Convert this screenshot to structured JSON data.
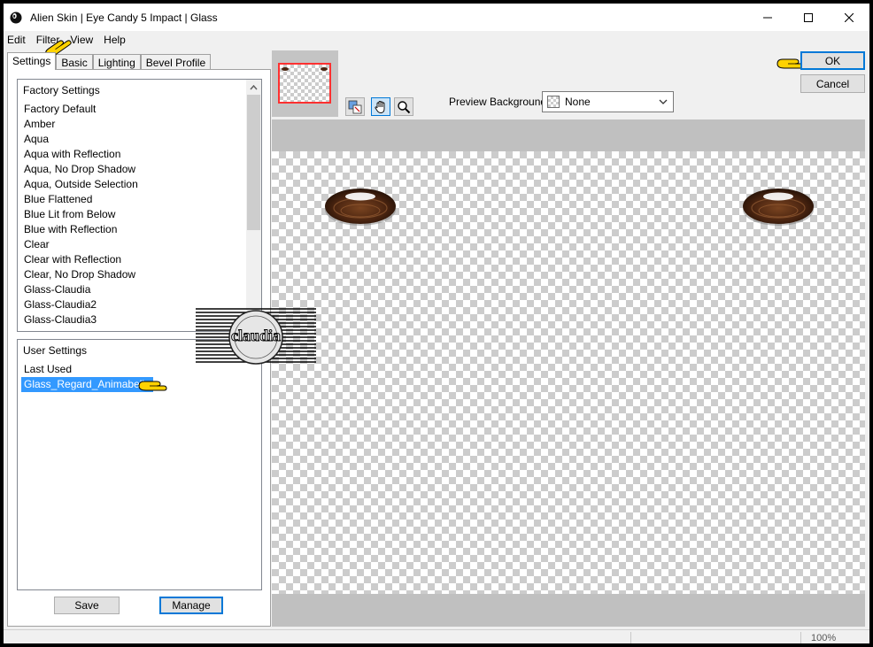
{
  "window": {
    "title": "Alien Skin | Eye Candy 5 Impact | Glass"
  },
  "menu": [
    "Edit",
    "Filter",
    "View",
    "Help"
  ],
  "tabs": [
    "Settings",
    "Basic",
    "Lighting",
    "Bevel Profile"
  ],
  "factory_settings": {
    "header": "Factory Settings",
    "items": [
      "Factory Default",
      "Amber",
      "Aqua",
      "Aqua with Reflection",
      "Aqua, No Drop Shadow",
      "Aqua, Outside Selection",
      "Blue Flattened",
      "Blue Lit from Below",
      "Blue with Reflection",
      "Clear",
      "Clear with Reflection",
      "Clear, No Drop Shadow",
      "Glass-Claudia",
      "Glass-Claudia2",
      "Glass-Claudia3"
    ]
  },
  "user_settings": {
    "header": "User Settings",
    "items": [
      "Last Used",
      "Glass_Regard_Animabelle"
    ],
    "selected": "Glass_Regard_Animabelle"
  },
  "buttons": {
    "save": "Save",
    "manage": "Manage",
    "ok": "OK",
    "cancel": "Cancel"
  },
  "preview": {
    "background_label": "Preview Background:",
    "background_value": "None"
  },
  "watermark": {
    "text": "claudia"
  },
  "status": {
    "zoom": "100%"
  },
  "colors": {
    "accent": "#0078d7",
    "selection": "#3399ff",
    "pointer_hand": "#ffd200",
    "bead": "#4a2410"
  }
}
